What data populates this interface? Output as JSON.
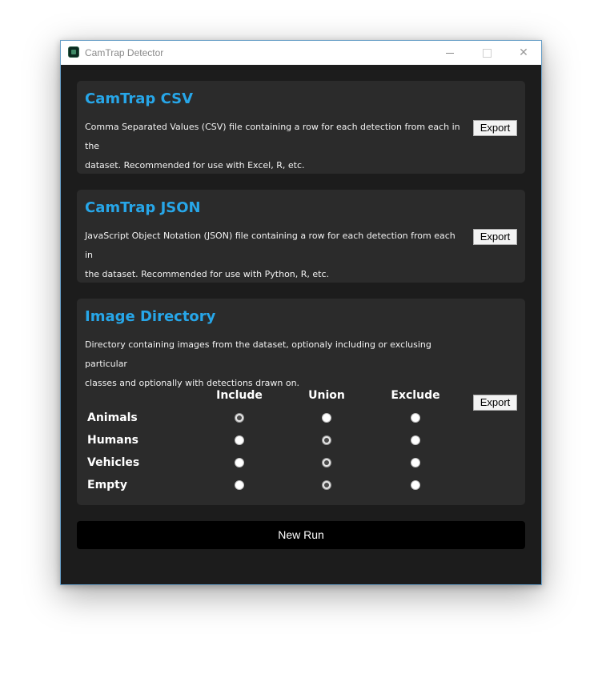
{
  "window": {
    "title": "CamTrap Detector",
    "minimize_glyph": "",
    "maximize_glyph": "",
    "close_glyph": "✕"
  },
  "csv": {
    "title": "CamTrap CSV",
    "description_line1": "Comma Separated Values (CSV) file containing a row for each detection from each in the",
    "description_line2": "dataset. Recommended for use with Excel, R, etc.",
    "export_label": "Export"
  },
  "json": {
    "title": "CamTrap JSON",
    "description_line1": "JavaScript Object Notation (JSON) file containing a row for each detection from each in",
    "description_line2": "the dataset. Recommended for use with Python, R, etc.",
    "export_label": "Export"
  },
  "image_dir": {
    "title": "Image Directory",
    "description_line1": "Directory containing images from the dataset, optionaly including or exclusing particular",
    "description_line2": "classes and optionally with detections drawn on.",
    "export_label": "Export",
    "columns": [
      "Include",
      "Union",
      "Exclude"
    ],
    "rows": [
      {
        "label": "Animals",
        "selected": "Include"
      },
      {
        "label": "Humans",
        "selected": "Union"
      },
      {
        "label": "Vehicles",
        "selected": "Union"
      },
      {
        "label": "Empty",
        "selected": "Union"
      }
    ]
  },
  "new_run_label": "New Run"
}
